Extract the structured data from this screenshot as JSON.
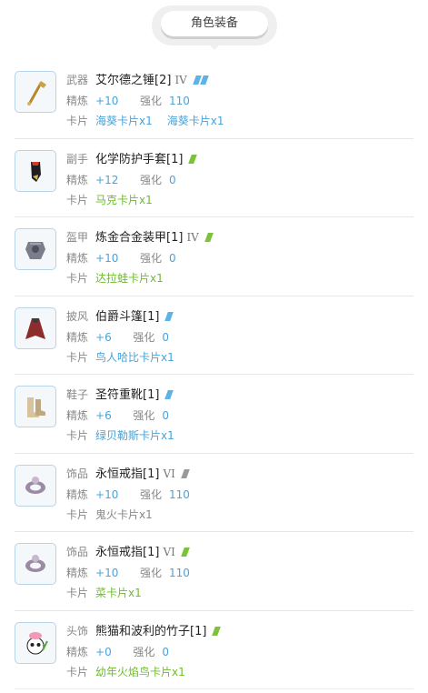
{
  "header": {
    "title": "角色装备"
  },
  "labels": {
    "refine": "精炼",
    "enhance": "强化",
    "card": "卡片"
  },
  "colors": {
    "blue": "#5bb3e6",
    "green": "#7cc33a",
    "gray": "#9a9a9a"
  },
  "items": [
    {
      "slot": "武器",
      "name": "艾尔德之锤[2]",
      "tier": "IV",
      "badges": [
        "blue",
        "blue"
      ],
      "refine": "+10",
      "enhance": "110",
      "cards": [
        "海葵卡片x1",
        "海葵卡片x1"
      ],
      "card_color": "blue",
      "icon": "hammer-icon"
    },
    {
      "slot": "副手",
      "name": "化学防护手套[1]",
      "tier": "",
      "badges": [
        "green"
      ],
      "refine": "+12",
      "enhance": "0",
      "cards": [
        "马克卡片x1"
      ],
      "card_color": "green",
      "icon": "glove-icon"
    },
    {
      "slot": "盔甲",
      "name": "炼金合金装甲[1]",
      "tier": "IV",
      "badges": [
        "green"
      ],
      "refine": "+10",
      "enhance": "0",
      "cards": [
        "达拉蛙卡片x1"
      ],
      "card_color": "green",
      "icon": "armor-icon"
    },
    {
      "slot": "披风",
      "name": "伯爵斗篷[1]",
      "tier": "",
      "badges": [
        "blue"
      ],
      "refine": "+6",
      "enhance": "0",
      "cards": [
        "鸟人哈比卡片x1"
      ],
      "card_color": "blue",
      "icon": "cloak-icon"
    },
    {
      "slot": "鞋子",
      "name": "圣符重靴[1]",
      "tier": "",
      "badges": [
        "blue"
      ],
      "refine": "+6",
      "enhance": "0",
      "cards": [
        "绿贝勒斯卡片x1"
      ],
      "card_color": "blue",
      "icon": "boots-icon"
    },
    {
      "slot": "饰品",
      "name": "永恒戒指[1]",
      "tier": "VI",
      "badges": [
        "gray"
      ],
      "refine": "+10",
      "enhance": "110",
      "cards": [
        "鬼火卡片x1"
      ],
      "card_color": "gray",
      "icon": "ring-icon"
    },
    {
      "slot": "饰品",
      "name": "永恒戒指[1]",
      "tier": "VI",
      "badges": [
        "green"
      ],
      "refine": "+10",
      "enhance": "110",
      "cards": [
        "菜卡片x1"
      ],
      "card_color": "green",
      "icon": "ring-icon"
    },
    {
      "slot": "头饰",
      "name": "熊猫和波利的竹子[1]",
      "tier": "",
      "badges": [
        "green"
      ],
      "refine": "+0",
      "enhance": "0",
      "cards": [
        "幼年火焰鸟卡片x1"
      ],
      "card_color": "green",
      "icon": "panda-headgear-icon"
    }
  ]
}
